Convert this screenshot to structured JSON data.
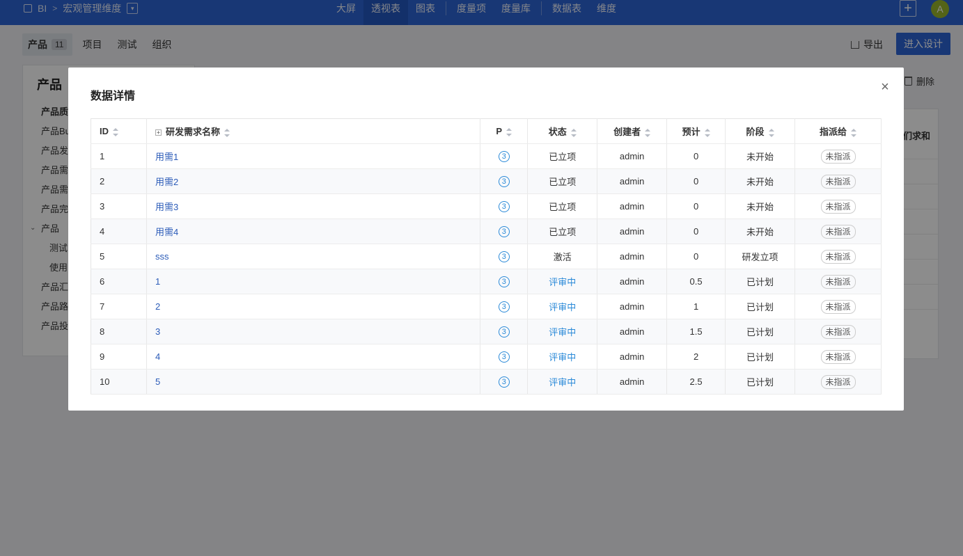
{
  "topbar": {
    "crumb_root": "BI",
    "crumb_separator": ">",
    "crumb_current": "宏观管理维度",
    "nav": [
      "大屏",
      "透视表",
      "图表",
      "度量项",
      "度量库",
      "数据表",
      "维度"
    ],
    "active_nav": "透视表",
    "avatar_letter": "A"
  },
  "toolbar": {
    "tabs": [
      {
        "label": "产品",
        "count": "11"
      },
      {
        "label": "项目"
      },
      {
        "label": "测试"
      },
      {
        "label": "组织"
      }
    ],
    "export_label": "导出",
    "design_label": "进入设计",
    "delete_label": "删除"
  },
  "left_panel": {
    "title": "产品",
    "items": [
      "产品质",
      "产品Bu",
      "产品发",
      "产品需",
      "产品需",
      "产品完",
      "产品",
      "测试",
      "使用",
      "产品汇",
      "产品路",
      "产品投"
    ]
  },
  "right_panel": {
    "header_text": "们求和"
  },
  "modal": {
    "title": "数据详情",
    "close_icon": "×",
    "columns": [
      "ID",
      "研发需求名称",
      "P",
      "状态",
      "创建者",
      "预计",
      "阶段",
      "指派给"
    ],
    "expand_icon": "+",
    "rows": [
      {
        "id": "1",
        "name": "用需1",
        "p": "3",
        "status": "已立项",
        "status_color": "default",
        "creator": "admin",
        "estimate": "0",
        "stage": "未开始",
        "assignee": "未指派"
      },
      {
        "id": "2",
        "name": "用需2",
        "p": "3",
        "status": "已立项",
        "status_color": "default",
        "creator": "admin",
        "estimate": "0",
        "stage": "未开始",
        "assignee": "未指派"
      },
      {
        "id": "3",
        "name": "用需3",
        "p": "3",
        "status": "已立项",
        "status_color": "default",
        "creator": "admin",
        "estimate": "0",
        "stage": "未开始",
        "assignee": "未指派"
      },
      {
        "id": "4",
        "name": "用需4",
        "p": "3",
        "status": "已立项",
        "status_color": "default",
        "creator": "admin",
        "estimate": "0",
        "stage": "未开始",
        "assignee": "未指派"
      },
      {
        "id": "5",
        "name": "sss",
        "p": "3",
        "status": "激活",
        "status_color": "default",
        "creator": "admin",
        "estimate": "0",
        "stage": "研发立项",
        "assignee": "未指派"
      },
      {
        "id": "6",
        "name": "1",
        "p": "3",
        "status": "评审中",
        "status_color": "blue",
        "creator": "admin",
        "estimate": "0.5",
        "stage": "已计划",
        "assignee": "未指派"
      },
      {
        "id": "7",
        "name": "2",
        "p": "3",
        "status": "评审中",
        "status_color": "blue",
        "creator": "admin",
        "estimate": "1",
        "stage": "已计划",
        "assignee": "未指派"
      },
      {
        "id": "8",
        "name": "3",
        "p": "3",
        "status": "评审中",
        "status_color": "blue",
        "creator": "admin",
        "estimate": "1.5",
        "stage": "已计划",
        "assignee": "未指派"
      },
      {
        "id": "9",
        "name": "4",
        "p": "3",
        "status": "评审中",
        "status_color": "blue",
        "creator": "admin",
        "estimate": "2",
        "stage": "已计划",
        "assignee": "未指派"
      },
      {
        "id": "10",
        "name": "5",
        "p": "3",
        "status": "评审中",
        "status_color": "blue",
        "creator": "admin",
        "estimate": "2.5",
        "stage": "已计划",
        "assignee": "未指派"
      }
    ]
  },
  "colors": {
    "brand": "#2c64d6",
    "link": "#2b5bb8",
    "status_blue": "#2b8ad8"
  }
}
